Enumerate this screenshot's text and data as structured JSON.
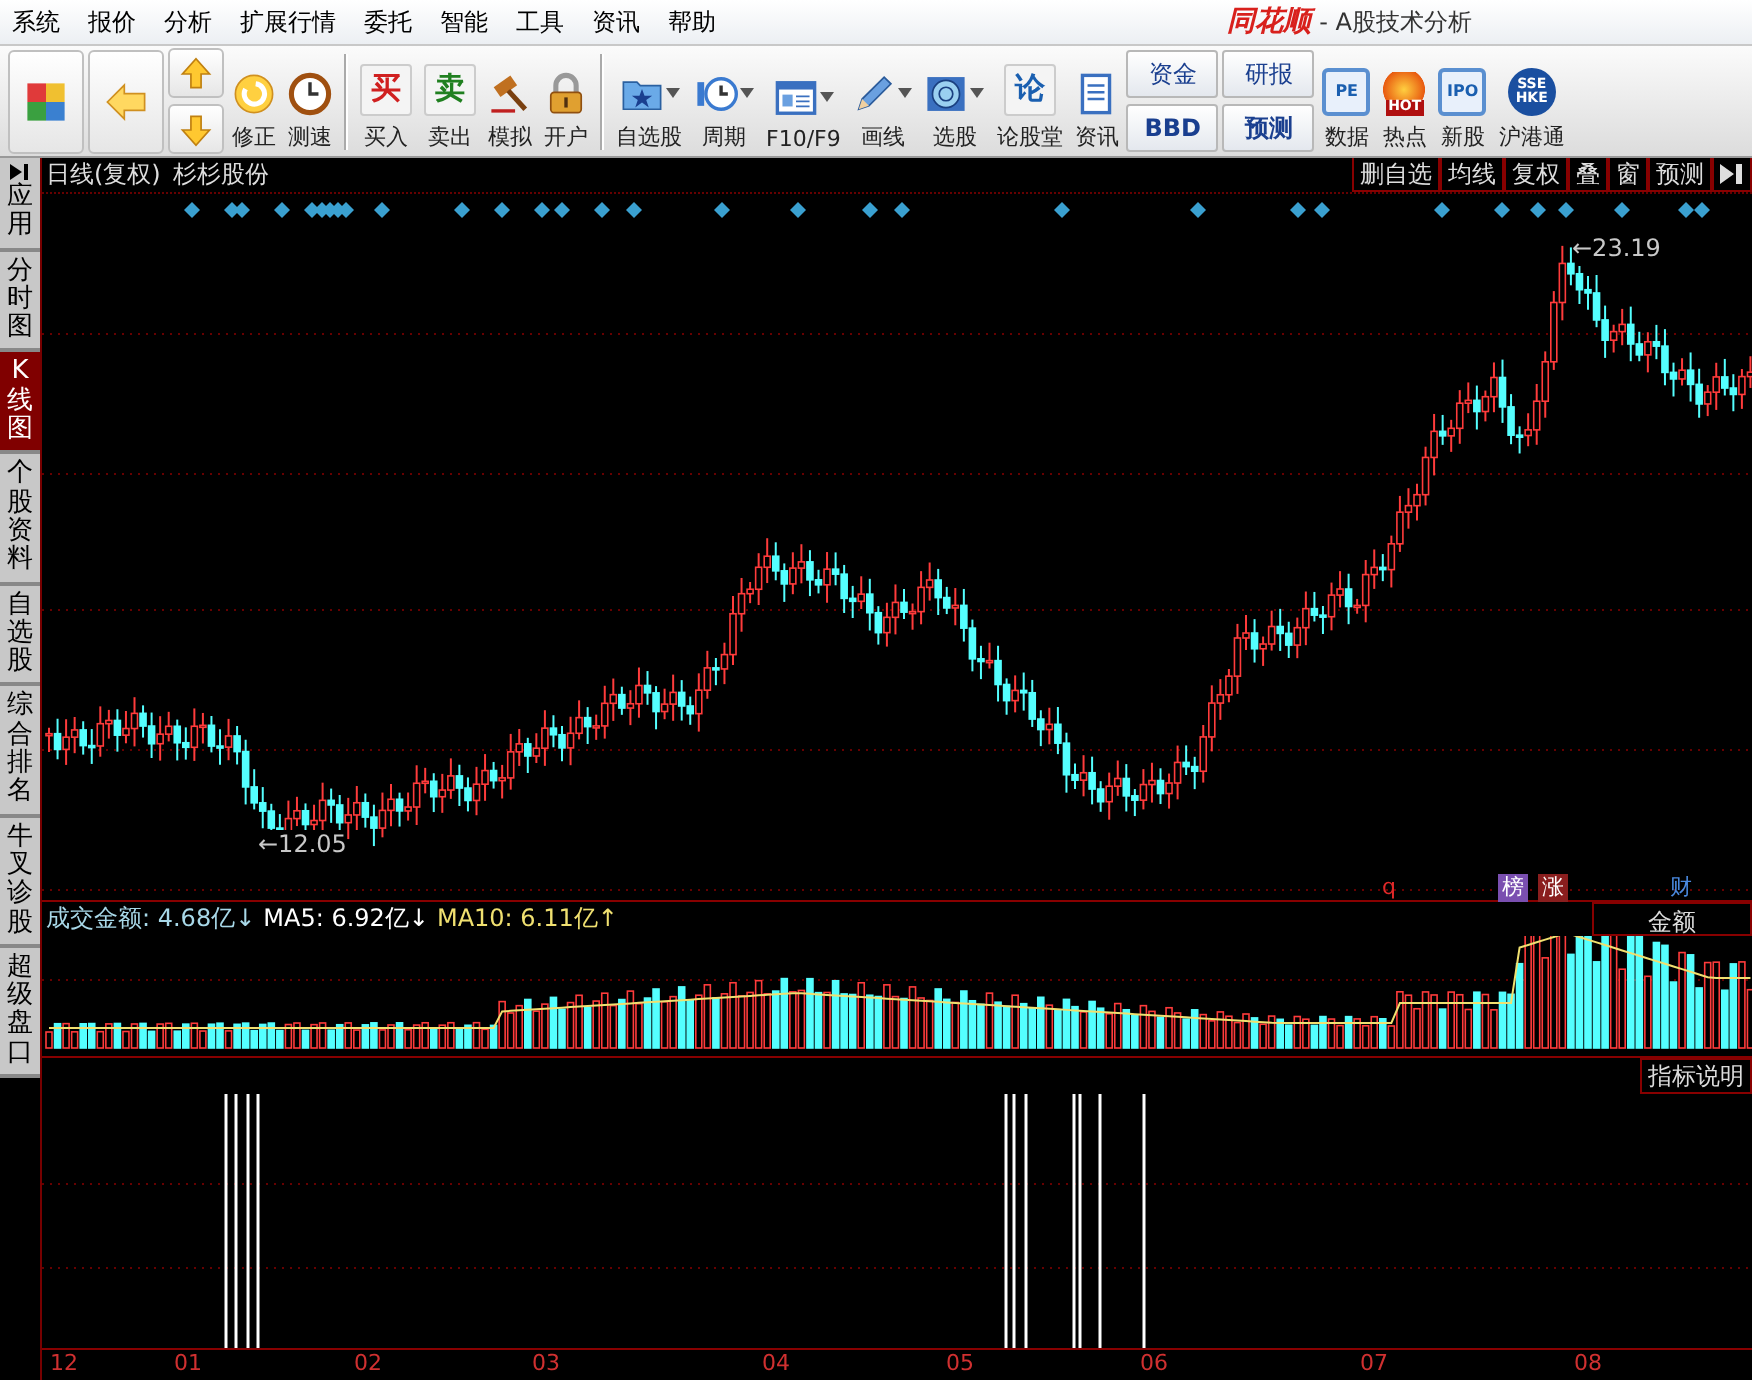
{
  "window": {
    "logo": "同花顺",
    "title": "- A股技术分析"
  },
  "menu": [
    "系统",
    "报价",
    "分析",
    "扩展行情",
    "委托",
    "智能",
    "工具",
    "资讯",
    "帮助"
  ],
  "toolbar_groups": [
    [
      {
        "kind": "tiles"
      },
      {
        "kind": "back"
      },
      {
        "kind": "updown"
      },
      {
        "kind": "refresh",
        "label": "修正"
      },
      {
        "kind": "clock",
        "label": "测速"
      }
    ],
    [
      {
        "kind": "glyph",
        "glyph": "买",
        "color": "#d02020",
        "label": "买入"
      },
      {
        "kind": "glyph",
        "glyph": "卖",
        "color": "#208020",
        "label": "卖出"
      },
      {
        "kind": "hammer",
        "label": "模拟"
      },
      {
        "kind": "lock",
        "label": "开户"
      }
    ],
    [
      {
        "kind": "folder",
        "label": "自选股"
      },
      {
        "kind": "period",
        "label": "周期"
      },
      {
        "kind": "card",
        "label": "F10/F9"
      },
      {
        "kind": "pencil",
        "label": "画线"
      },
      {
        "kind": "radar",
        "label": "选股"
      },
      {
        "kind": "glyph",
        "glyph": "论",
        "color": "#1a5fb0",
        "label": "论股堂"
      },
      {
        "kind": "doc",
        "label": "资讯"
      },
      {
        "kind": "pair",
        "top": "资金",
        "bottom": "BBD"
      },
      {
        "kind": "pair",
        "top": "研报",
        "bottom": "预测"
      },
      {
        "kind": "badge",
        "glyph": "PE",
        "label": "数据"
      },
      {
        "kind": "fire",
        "glyph": "HOT",
        "label": "热点"
      },
      {
        "kind": "badge",
        "glyph": "IPO",
        "label": "新股"
      },
      {
        "kind": "globe",
        "glyph": "SSE HKE",
        "label": "沪港通"
      }
    ]
  ],
  "sidebar": [
    {
      "kind": "apply",
      "label": "应用",
      "selected": false
    },
    {
      "kind": "tab",
      "label": "分时图",
      "selected": false
    },
    {
      "kind": "tab",
      "label": "K线图",
      "selected": true
    },
    {
      "kind": "tab",
      "label": "个股资料",
      "selected": false
    },
    {
      "kind": "tab",
      "label": "自选股",
      "selected": false
    },
    {
      "kind": "tab",
      "label": "综合排名",
      "selected": false
    },
    {
      "kind": "tab",
      "label": "牛叉诊股",
      "selected": false
    },
    {
      "kind": "tab",
      "label": "超级盘口",
      "selected": false
    }
  ],
  "chart": {
    "period": "日线(复权)",
    "stock": "杉杉股份",
    "buttons": [
      "删自选",
      "均线",
      "复权",
      "叠",
      "窗",
      "预测"
    ],
    "high_mark": "←23.19",
    "low_mark": "←12.05",
    "event_marks": [
      {
        "kind": "plain",
        "text": "q",
        "color": "#e02828"
      },
      {
        "kind": "boxed",
        "text": "榜",
        "color": "#7a4fb0"
      },
      {
        "kind": "boxed",
        "text": "涨",
        "color": "#8a1e1e"
      },
      {
        "kind": "plain",
        "text": "财",
        "color": "#4a8ae0"
      }
    ]
  },
  "volume": {
    "button": "金额",
    "help_button": "指标说明",
    "legend": [
      {
        "label": "成交金额:",
        "value": "4.68亿",
        "arrow": "↓",
        "color": "#a8d8e8"
      },
      {
        "label": "MA5:",
        "value": "6.92亿",
        "arrow": "↓",
        "color": "#ffffff"
      },
      {
        "label": "MA10:",
        "value": "6.11亿",
        "arrow": "↑",
        "color": "#f0e070"
      }
    ]
  },
  "axis": [
    "12",
    "01",
    "02",
    "03",
    "04",
    "05",
    "06",
    "07",
    "08"
  ]
}
